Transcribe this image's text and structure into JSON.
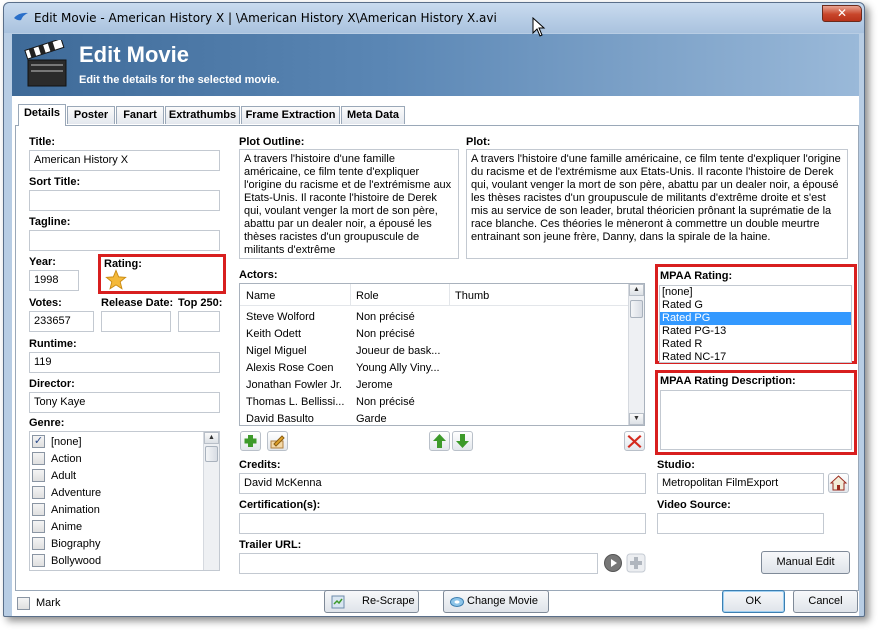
{
  "window": {
    "title": "Edit Movie - American History X | \\American History X\\American History X.avi",
    "close_symbol": "✕"
  },
  "banner": {
    "title": "Edit Movie",
    "subtitle": "Edit the details for the selected movie."
  },
  "tabs": [
    {
      "label": "Details",
      "active": true
    },
    {
      "label": "Poster"
    },
    {
      "label": "Fanart"
    },
    {
      "label": "Extrathumbs"
    },
    {
      "label": "Frame Extraction"
    },
    {
      "label": "Meta Data"
    }
  ],
  "details": {
    "title_label": "Title:",
    "title_value": "American History X",
    "sort_title_label": "Sort Title:",
    "sort_title_value": "",
    "tagline_label": "Tagline:",
    "tagline_value": "",
    "year_label": "Year:",
    "year_value": "1998",
    "rating_label": "Rating:",
    "rating_stars": 1,
    "votes_label": "Votes:",
    "votes_value": "233657",
    "release_date_label": "Release Date:",
    "release_date_value": "",
    "top250_label": "Top 250:",
    "top250_value": "",
    "runtime_label": "Runtime:",
    "runtime_value": "119",
    "director_label": "Director:",
    "director_value": "Tony Kaye",
    "genre_label": "Genre:",
    "genres": [
      {
        "name": "[none]",
        "checked": true
      },
      {
        "name": "Action",
        "checked": false
      },
      {
        "name": "Adult",
        "checked": false
      },
      {
        "name": "Adventure",
        "checked": false
      },
      {
        "name": "Animation",
        "checked": false
      },
      {
        "name": "Anime",
        "checked": false
      },
      {
        "name": "Biography",
        "checked": false
      },
      {
        "name": "Bollywood",
        "checked": false
      }
    ],
    "plot_outline_label": "Plot Outline:",
    "plot_outline_value": "A travers l'histoire d'une famille américaine, ce film tente d'expliquer l'origine du racisme et de l'extrémisme aux Etats-Unis. Il raconte l'histoire de Derek qui, voulant venger la mort de son père, abattu par un dealer noir, a épousé les thèses racistes d'un groupuscule de militants d'extrême",
    "plot_label": "Plot:",
    "plot_value": "A travers l'histoire d'une famille américaine, ce film tente d'expliquer l'origine du racisme et de l'extrémisme aux Etats-Unis. Il raconte l'histoire de Derek qui, voulant venger la mort de son père, abattu par un dealer noir, a épousé les thèses racistes d'un groupuscule de militants d'extrême droite et s'est mis au service de son leader, brutal théoricien prônant la suprématie de la race blanche. Ces théories le mèneront à commettre un double meurtre entrainant son jeune frère, Danny, dans la spirale de la haine.",
    "actors_label": "Actors:",
    "actor_columns": [
      "Name",
      "Role",
      "Thumb"
    ],
    "actors": [
      {
        "name": "Steve Wolford",
        "role": "Non précisé"
      },
      {
        "name": "Keith Odett",
        "role": "Non précisé"
      },
      {
        "name": "Nigel Miguel",
        "role": "Joueur de bask..."
      },
      {
        "name": "Alexis Rose Coen",
        "role": "Young Ally Viny..."
      },
      {
        "name": "Jonathan Fowler Jr.",
        "role": "Jerome"
      },
      {
        "name": "Thomas L. Bellissi...",
        "role": "Non précisé"
      },
      {
        "name": "David Basulto",
        "role": "Garde"
      }
    ],
    "credits_label": "Credits:",
    "credits_value": "David McKenna",
    "certification_label": "Certification(s):",
    "certification_value": "",
    "trailer_label": "Trailer URL:",
    "trailer_value": "",
    "mpaa_label": "MPAA Rating:",
    "mpaa_options": [
      "[none]",
      "Rated G",
      "Rated PG",
      "Rated PG-13",
      "Rated R",
      "Rated NC-17"
    ],
    "mpaa_selected": "Rated PG",
    "mpaa_desc_label": "MPAA Rating Description:",
    "mpaa_desc_value": "",
    "studio_label": "Studio:",
    "studio_value": "Metropolitan FilmExport",
    "video_source_label": "Video Source:",
    "video_source_value": "",
    "manual_edit_label": "Manual Edit"
  },
  "footer": {
    "mark_label": "Mark",
    "rescrape_label": "Re-Scrape",
    "change_movie_label": "Change Movie",
    "ok_label": "OK",
    "cancel_label": "Cancel"
  },
  "colors": {
    "highlight": "#d81f1f",
    "selection": "#3399ff",
    "banner": "#4f7bab"
  }
}
